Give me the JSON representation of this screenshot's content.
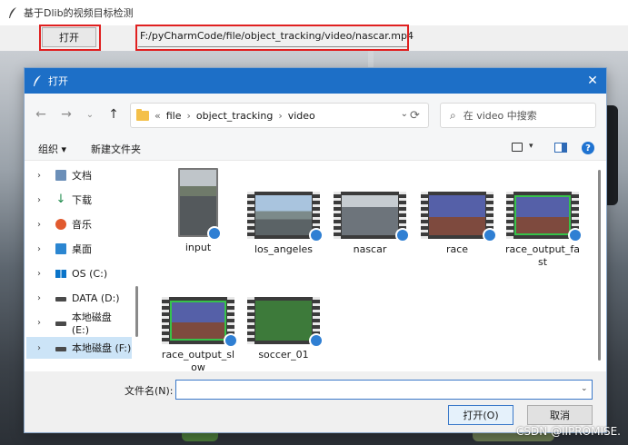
{
  "app": {
    "title": "基于Dlib的视频目标检测",
    "open_button_label": "打开",
    "file_path": "F:/pyCharmCode/file/object_tracking/video/nascar.mp4"
  },
  "dialog": {
    "title": "打开",
    "close_icon": "✕",
    "nav": {
      "back_icon": "←",
      "forward_icon": "→",
      "recent_icon": "⌄",
      "up_icon": "↑",
      "refresh_icon": "⟳"
    },
    "breadcrumb": {
      "prefix": "«",
      "items": [
        "file",
        "object_tracking",
        "video"
      ],
      "separator": "›"
    },
    "search": {
      "icon": "⌕",
      "placeholder": "在 video 中搜索"
    },
    "commands": {
      "organize": "组织 ▾",
      "new_folder": "新建文件夹",
      "view_dropdown": "▾",
      "help": "?"
    },
    "sidebar": {
      "items": [
        {
          "label": "文档",
          "icon": "document-icon"
        },
        {
          "label": "下载",
          "icon": "download-icon"
        },
        {
          "label": "音乐",
          "icon": "music-icon"
        },
        {
          "label": "桌面",
          "icon": "desktop-icon"
        },
        {
          "label": "OS (C:)",
          "icon": "windows-drive-icon"
        },
        {
          "label": "DATA (D:)",
          "icon": "drive-icon"
        },
        {
          "label": "本地磁盘 (E:)",
          "icon": "drive-icon"
        },
        {
          "label": "本地磁盘 (F:)",
          "icon": "drive-icon",
          "selected": true
        }
      ],
      "chevron": "›"
    },
    "files": [
      {
        "name": "input"
      },
      {
        "name": "los_angeles"
      },
      {
        "name": "nascar"
      },
      {
        "name": "race"
      },
      {
        "name": "race_output_fast"
      },
      {
        "name": "race_output_slow"
      },
      {
        "name": "soccer_01"
      }
    ],
    "filename_label": "文件名(N):",
    "filename_value": "",
    "dropdown_icon": "⌄",
    "open_button_label": "打开(O)",
    "cancel_button_label": "取消"
  },
  "watermark": "CSDN @IIPROMISE.",
  "colors": {
    "accent": "#1d6fc7",
    "highlight_box": "#e02020",
    "selection": "#cce4f7"
  }
}
